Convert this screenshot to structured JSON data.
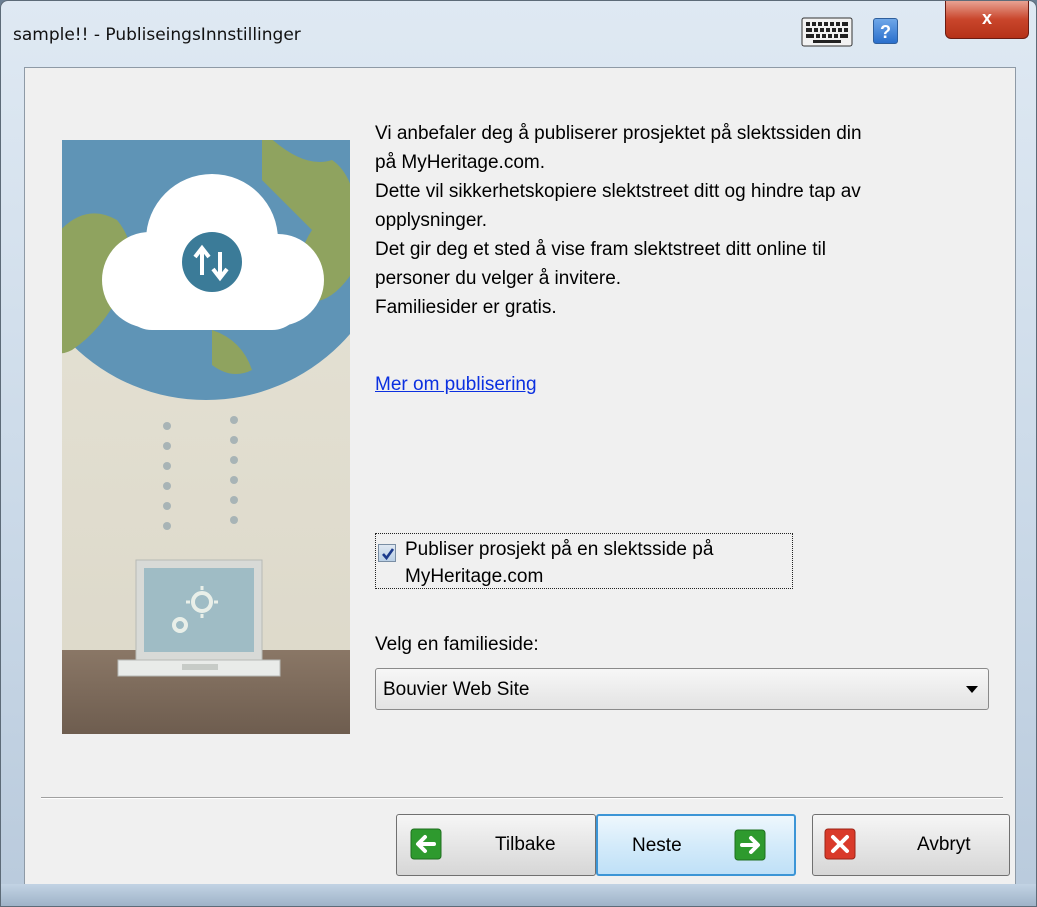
{
  "window": {
    "title": "sample!! - PubliseingsInnstillinger",
    "help_label": "?",
    "close_label": "x"
  },
  "content": {
    "description_lines": [
      "Vi anbefaler deg å publiserer prosjektet på slektssiden din",
      "på MyHeritage.com.",
      "Dette vil sikkerhetskopiere slektstreet ditt og hindre tap av",
      "opplysninger.",
      "Det gir deg et sted å vise fram slektstreet ditt online til",
      "personer du velger å invitere.",
      "Familiesider er gratis."
    ],
    "link_text": "Mer om publisering",
    "publish_checkbox": {
      "label_line1": "Publiser prosjekt på en slektsside på",
      "label_line2": "MyHeritage.com",
      "checked": true
    },
    "family_site": {
      "label": "Velg en familieside:",
      "selected": "Bouvier Web Site"
    }
  },
  "buttons": {
    "back": "Tilbake",
    "next": "Neste",
    "cancel": "Avbryt"
  },
  "icons": {
    "keyboard": "keyboard-icon",
    "help": "help-icon",
    "close": "close-icon",
    "back": "arrow-left-icon",
    "next": "arrow-right-icon",
    "cancel": "x-icon"
  },
  "colors": {
    "link": "#0b30e0",
    "green_arrow": "#2e9a2e",
    "red_x": "#d93a2a",
    "focus_border": "#3c95d6"
  }
}
